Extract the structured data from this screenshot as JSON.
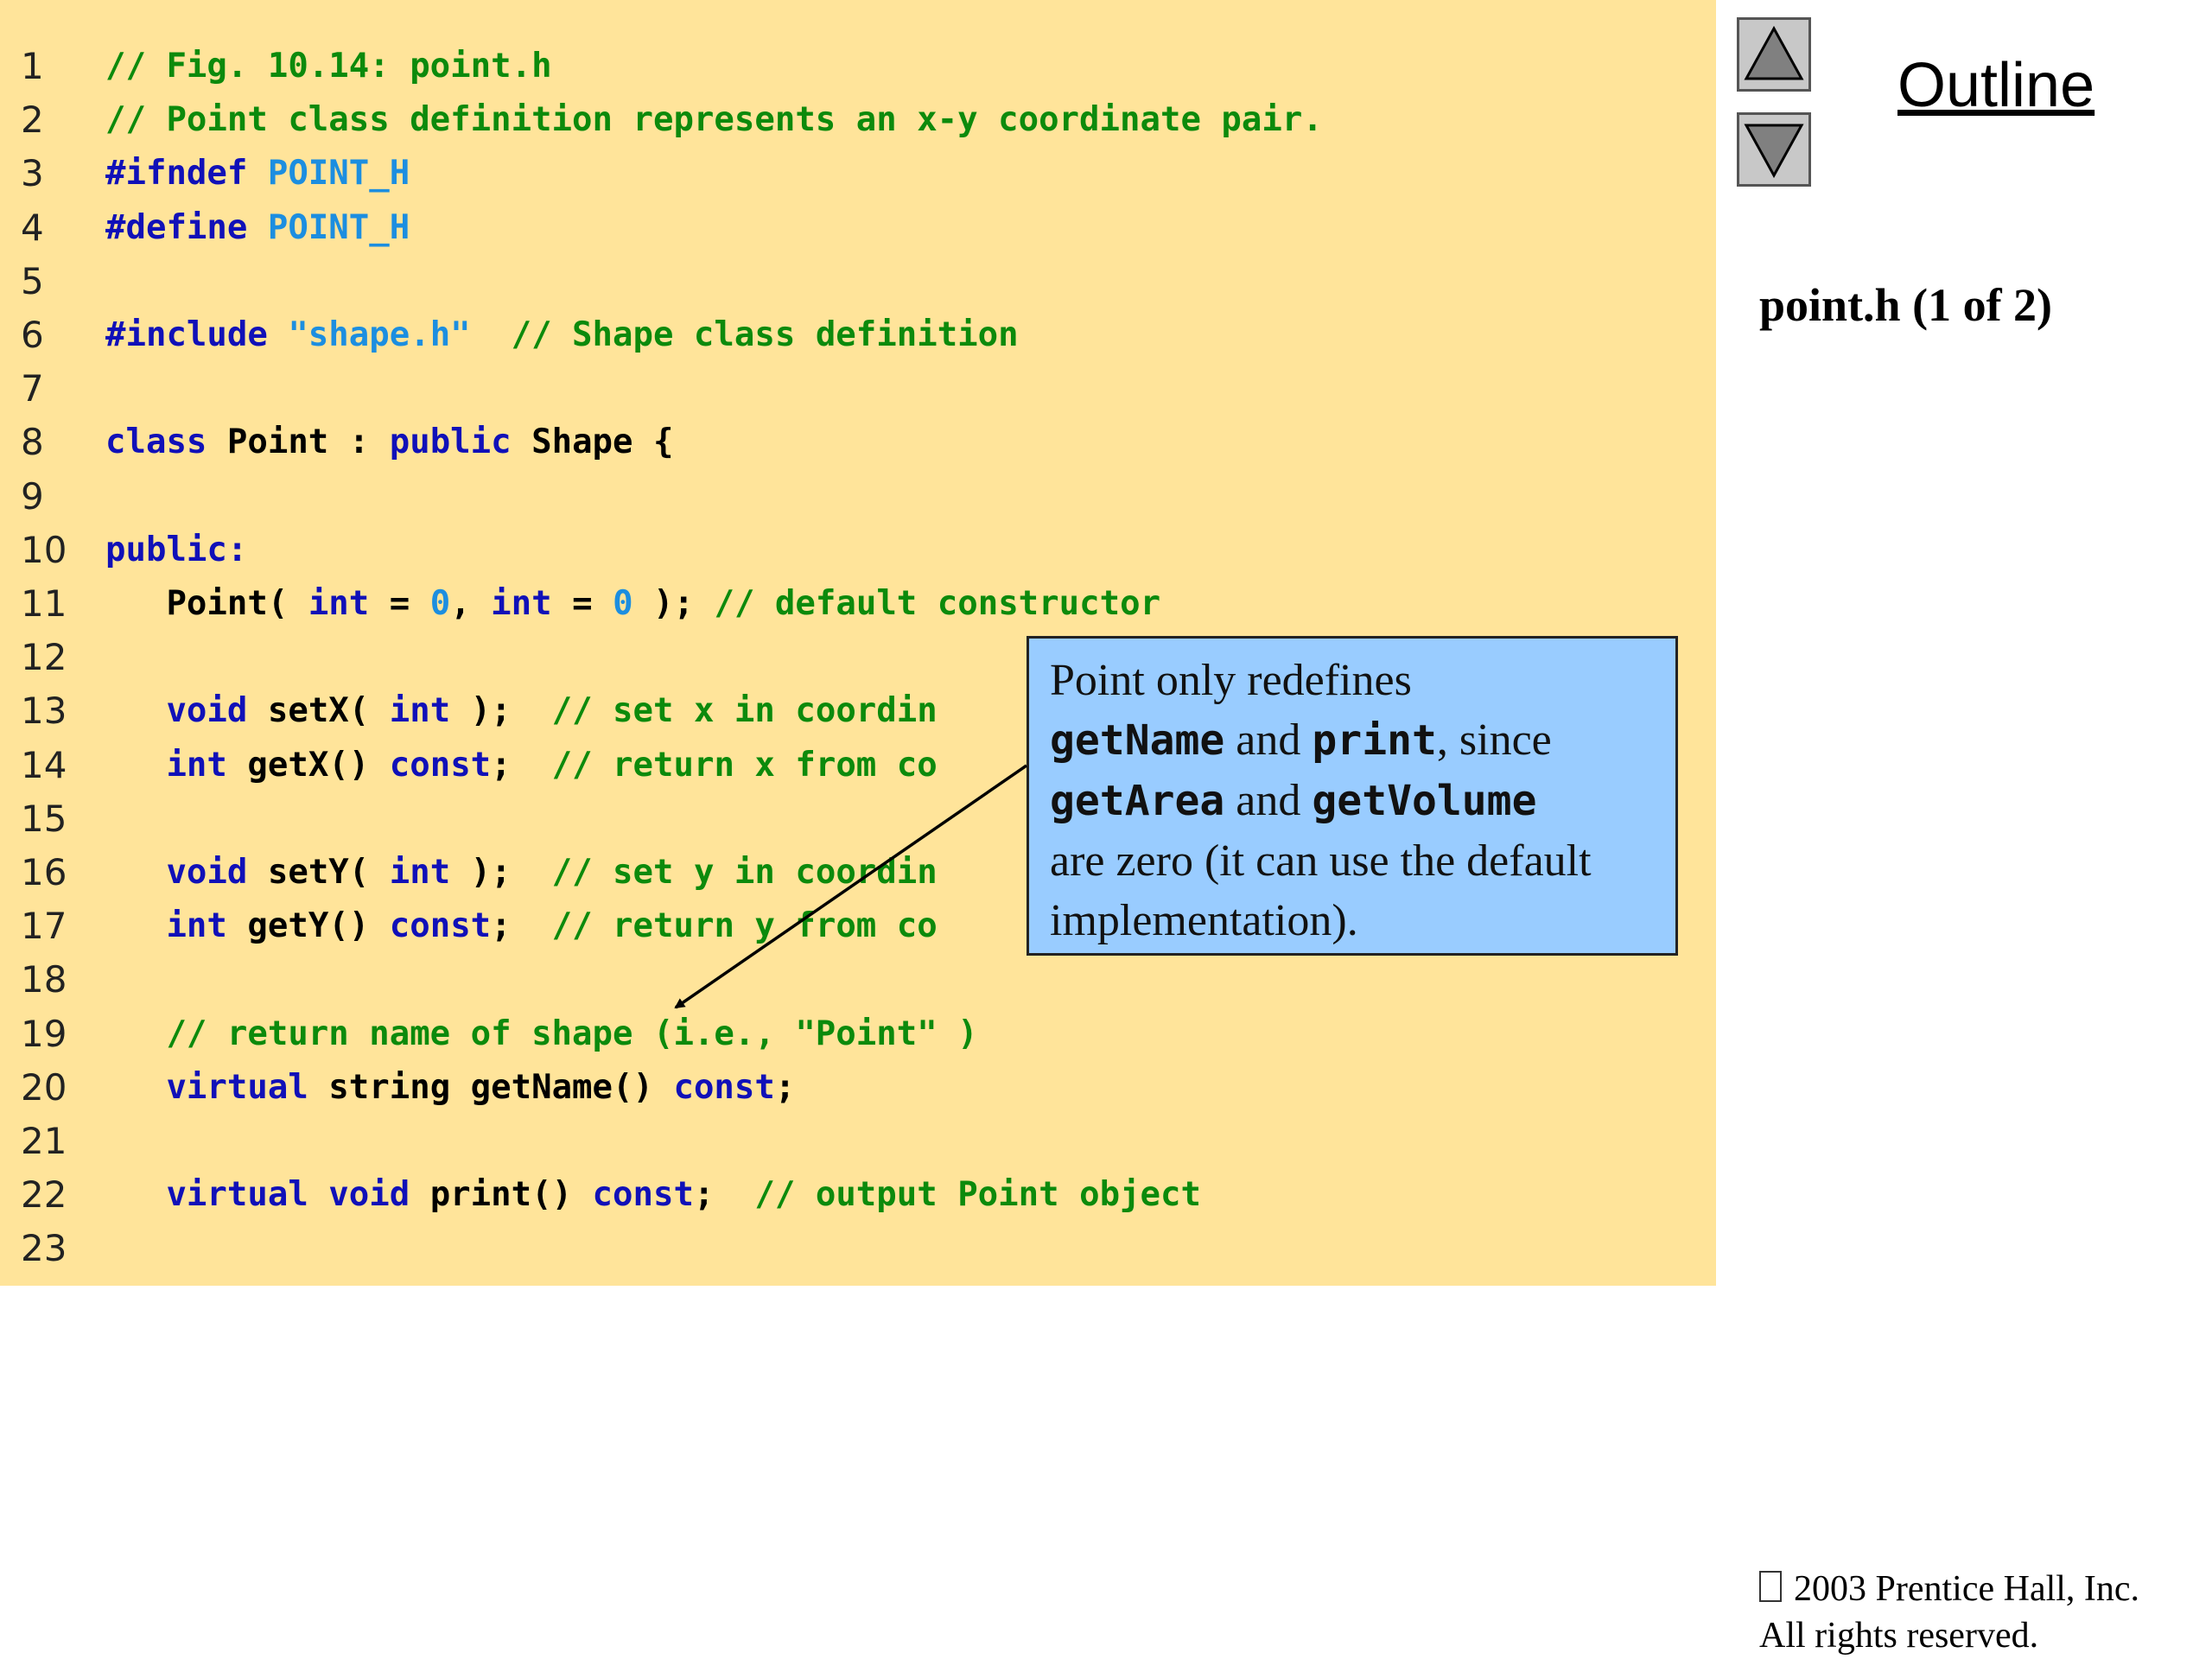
{
  "navigation": {
    "outline_label": "Outline",
    "up_icon": "triangle-up-icon",
    "down_icon": "triangle-down-icon"
  },
  "file_label": "point.h (1 of 2)",
  "code_lines": [
    {
      "num": "1",
      "tokens": [
        {
          "t": "// Fig. 10.14: point.h",
          "c": "cm"
        }
      ]
    },
    {
      "num": "2",
      "tokens": [
        {
          "t": "// Point class definition represents an x-y coordinate pair.",
          "c": "cm"
        }
      ]
    },
    {
      "num": "3",
      "tokens": [
        {
          "t": "#ifndef ",
          "c": "kw"
        },
        {
          "t": "POINT_H",
          "c": "lit"
        }
      ]
    },
    {
      "num": "4",
      "tokens": [
        {
          "t": "#define ",
          "c": "kw"
        },
        {
          "t": "POINT_H",
          "c": "lit"
        }
      ]
    },
    {
      "num": "5",
      "tokens": []
    },
    {
      "num": "6",
      "tokens": [
        {
          "t": "#include ",
          "c": "kw"
        },
        {
          "t": "\"shape.h\"",
          "c": "lit"
        },
        {
          "t": "  // Shape class definition",
          "c": "cm"
        }
      ]
    },
    {
      "num": "7",
      "tokens": []
    },
    {
      "num": "8",
      "tokens": [
        {
          "t": "class ",
          "c": "kw"
        },
        {
          "t": "Point : ",
          "c": "plain"
        },
        {
          "t": "public ",
          "c": "kw"
        },
        {
          "t": "Shape {",
          "c": "plain"
        }
      ]
    },
    {
      "num": "9",
      "tokens": []
    },
    {
      "num": "10",
      "tokens": [
        {
          "t": "public:",
          "c": "kw"
        }
      ]
    },
    {
      "num": "11",
      "tokens": [
        {
          "t": "   Point( ",
          "c": "plain"
        },
        {
          "t": "int",
          "c": "kw"
        },
        {
          "t": " = ",
          "c": "plain"
        },
        {
          "t": "0",
          "c": "lit"
        },
        {
          "t": ", ",
          "c": "plain"
        },
        {
          "t": "int",
          "c": "kw"
        },
        {
          "t": " = ",
          "c": "plain"
        },
        {
          "t": "0",
          "c": "lit"
        },
        {
          "t": " ); ",
          "c": "plain"
        },
        {
          "t": "// default constructor",
          "c": "cm"
        }
      ]
    },
    {
      "num": "12",
      "tokens": []
    },
    {
      "num": "13",
      "tokens": [
        {
          "t": "   ",
          "c": "plain"
        },
        {
          "t": "void ",
          "c": "kw"
        },
        {
          "t": "setX( ",
          "c": "plain"
        },
        {
          "t": "int",
          "c": "kw"
        },
        {
          "t": " );  ",
          "c": "plain"
        },
        {
          "t": "// set x in coordin",
          "c": "cm"
        }
      ]
    },
    {
      "num": "14",
      "tokens": [
        {
          "t": "   ",
          "c": "plain"
        },
        {
          "t": "int ",
          "c": "kw"
        },
        {
          "t": "getX() ",
          "c": "plain"
        },
        {
          "t": "const",
          "c": "kw"
        },
        {
          "t": ";  ",
          "c": "plain"
        },
        {
          "t": "// return x from co",
          "c": "cm"
        }
      ]
    },
    {
      "num": "15",
      "tokens": []
    },
    {
      "num": "16",
      "tokens": [
        {
          "t": "   ",
          "c": "plain"
        },
        {
          "t": "void ",
          "c": "kw"
        },
        {
          "t": "setY( ",
          "c": "plain"
        },
        {
          "t": "int",
          "c": "kw"
        },
        {
          "t": " );  ",
          "c": "plain"
        },
        {
          "t": "// set y in coordin",
          "c": "cm"
        }
      ]
    },
    {
      "num": "17",
      "tokens": [
        {
          "t": "   ",
          "c": "plain"
        },
        {
          "t": "int ",
          "c": "kw"
        },
        {
          "t": "getY() ",
          "c": "plain"
        },
        {
          "t": "const",
          "c": "kw"
        },
        {
          "t": ";  ",
          "c": "plain"
        },
        {
          "t": "// return y from co",
          "c": "cm"
        }
      ]
    },
    {
      "num": "18",
      "tokens": []
    },
    {
      "num": "19",
      "tokens": [
        {
          "t": "   // return name of shape (i.e., \"Point\" )",
          "c": "cm"
        }
      ]
    },
    {
      "num": "20",
      "tokens": [
        {
          "t": "   ",
          "c": "plain"
        },
        {
          "t": "virtual ",
          "c": "kw"
        },
        {
          "t": "string getName() ",
          "c": "plain"
        },
        {
          "t": "const",
          "c": "kw"
        },
        {
          "t": ";",
          "c": "plain"
        }
      ]
    },
    {
      "num": "21",
      "tokens": []
    },
    {
      "num": "22",
      "tokens": [
        {
          "t": "   ",
          "c": "plain"
        },
        {
          "t": "virtual void ",
          "c": "kw"
        },
        {
          "t": "print() ",
          "c": "plain"
        },
        {
          "t": "const",
          "c": "kw"
        },
        {
          "t": ";  ",
          "c": "plain"
        },
        {
          "t": "// output Point object",
          "c": "cm"
        }
      ]
    },
    {
      "num": "23",
      "tokens": []
    }
  ],
  "callout": {
    "text_1": "Point only redefines",
    "code_1": "getName",
    "text_2": " and ",
    "code_2": "print",
    "text_3": ", since",
    "code_3": "getArea",
    "text_4": " and ",
    "code_4": "getVolume",
    "text_5": "are zero (it can use the default implementation)."
  },
  "copyright": {
    "line1": "2003 Prentice Hall, Inc.",
    "line2": "All rights reserved."
  },
  "colors": {
    "code_background": "#ffe49a",
    "callout_background": "#99ccff",
    "keyword": "#1010b8",
    "comment": "#0c8a0c",
    "literal": "#1c8ee0"
  }
}
